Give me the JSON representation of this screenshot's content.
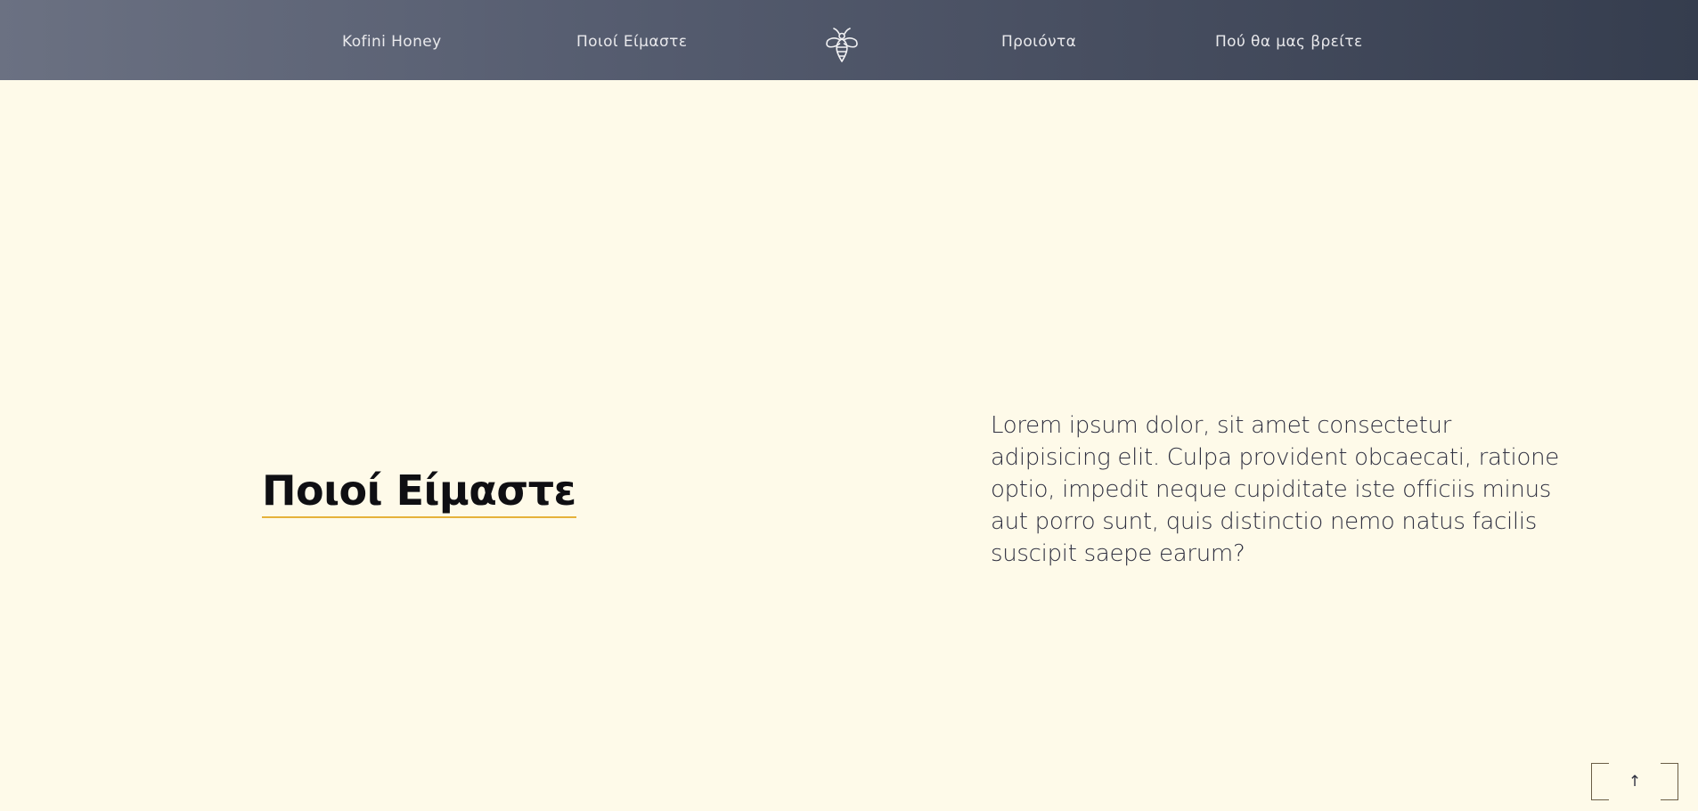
{
  "nav": {
    "brand": "Kofini Honey",
    "about": "Ποιοί Είμαστε",
    "logo_icon": "bee-icon",
    "products": "Προιόντα",
    "where": "Πού θα μας βρείτε"
  },
  "hero": {
    "heading": "Ποιοί Είμαστε",
    "text": "Lorem ipsum dolor, sit amet consectetur adipisicing elit. Culpa provident obcaecati, ratione optio, impedit neque cupiditate iste officiis minus aut porro sunt, quis distinctio nemo natus facilis suscipit saepe earum?"
  },
  "back_to_top": {
    "arrow": "↑",
    "icon": "arrow-up-icon"
  },
  "colors": {
    "background": "#fefae9",
    "nav_gradient_start": "#6b7182",
    "nav_gradient_end": "#353d4e",
    "heading_underline": "#e6b23a"
  }
}
